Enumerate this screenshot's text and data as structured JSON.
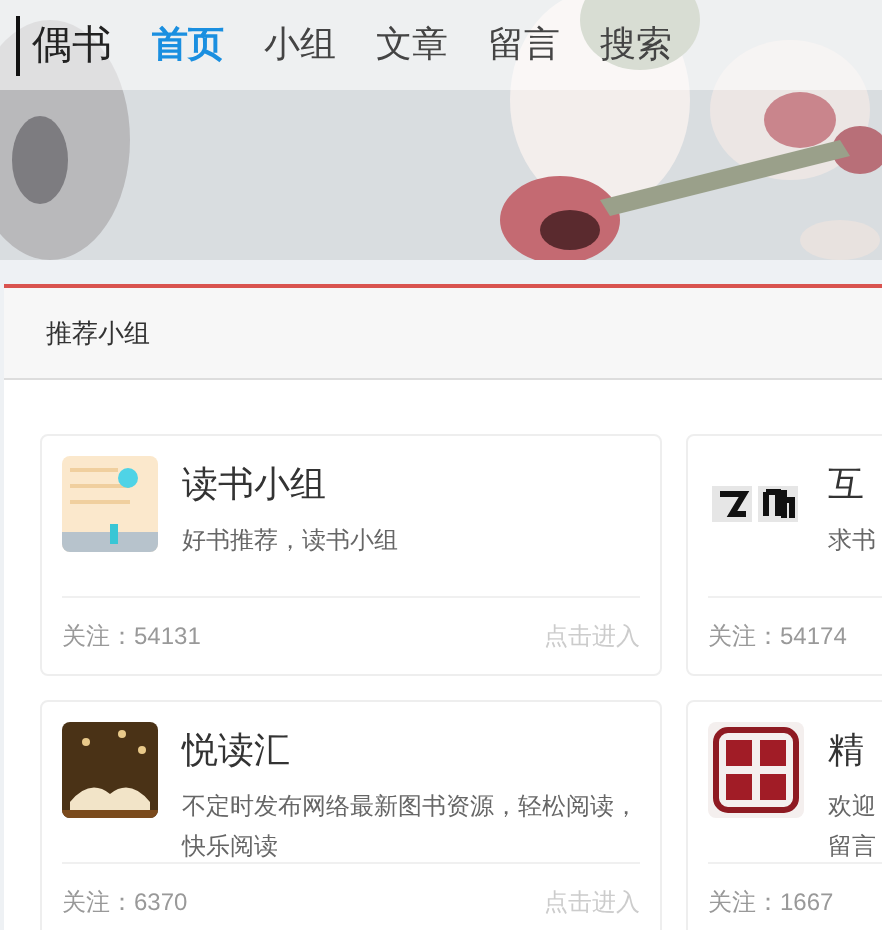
{
  "logo": "偶书",
  "nav": [
    {
      "label": "首页",
      "selected": true
    },
    {
      "label": "小组",
      "selected": false
    },
    {
      "label": "文章",
      "selected": false
    },
    {
      "label": "留言",
      "selected": false
    },
    {
      "label": "搜索",
      "selected": false
    }
  ],
  "panel": {
    "title": "推荐小组",
    "groups": [
      {
        "title": "读书小组",
        "description_lines": [
          "好书推荐，读书小组"
        ],
        "followers": "关注：54131",
        "action": "点击进入"
      },
      {
        "title": "互",
        "description_lines": [
          "求书"
        ],
        "followers": "关注：54174"
      },
      {
        "title": "悦读汇",
        "description_lines": [
          "不定时发布网络最新图书资源，轻松阅读，",
          "快乐阅读"
        ],
        "followers": "关注：6370",
        "action": "点击进入"
      },
      {
        "title": "精",
        "description_lines": [
          "欢迎",
          "留言"
        ],
        "followers": "关注：1667"
      }
    ]
  }
}
